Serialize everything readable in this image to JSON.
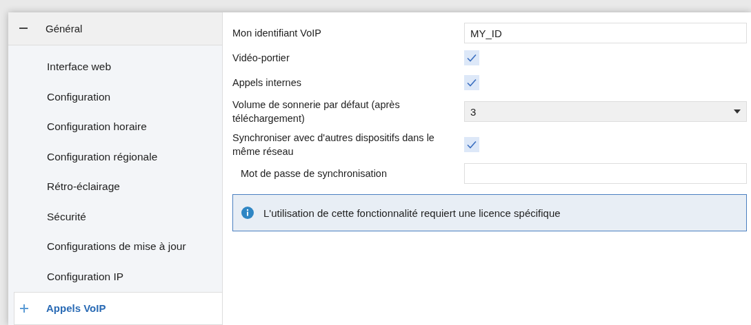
{
  "sidebar": {
    "groups": [
      {
        "label": "Général",
        "expanded": true,
        "selected": false,
        "children": [
          {
            "label": "Interface web",
            "selected": false
          },
          {
            "label": "Configuration",
            "selected": false
          },
          {
            "label": "Configuration horaire",
            "selected": false
          },
          {
            "label": "Configuration régionale",
            "selected": false
          },
          {
            "label": "Rétro-éclairage",
            "selected": false
          },
          {
            "label": "Sécurité",
            "selected": false
          },
          {
            "label": "Configurations de mise à jour",
            "selected": false
          },
          {
            "label": "Configuration IP",
            "selected": false
          }
        ]
      },
      {
        "label": "Appels VoIP",
        "expanded": false,
        "selected": true
      }
    ]
  },
  "settings": [
    {
      "kind": "text",
      "label": "Mon identifiant VoIP",
      "value": "MY_ID"
    },
    {
      "kind": "checkbox",
      "label": "Vidéo-portier",
      "checked": true
    },
    {
      "kind": "checkbox",
      "label": "Appels internes",
      "checked": true
    },
    {
      "kind": "select",
      "label": "Volume de sonnerie par défaut (après téléchargement)",
      "value": "3"
    },
    {
      "kind": "checkbox",
      "label": "Synchroniser avec d'autres dispositifs dans le même réseau",
      "checked": true
    },
    {
      "kind": "password",
      "label": "Mot de passe de synchronisation"
    }
  ],
  "notice": {
    "text": "L'utilisation de cette fonctionnalité requiert une licence spécifique"
  }
}
